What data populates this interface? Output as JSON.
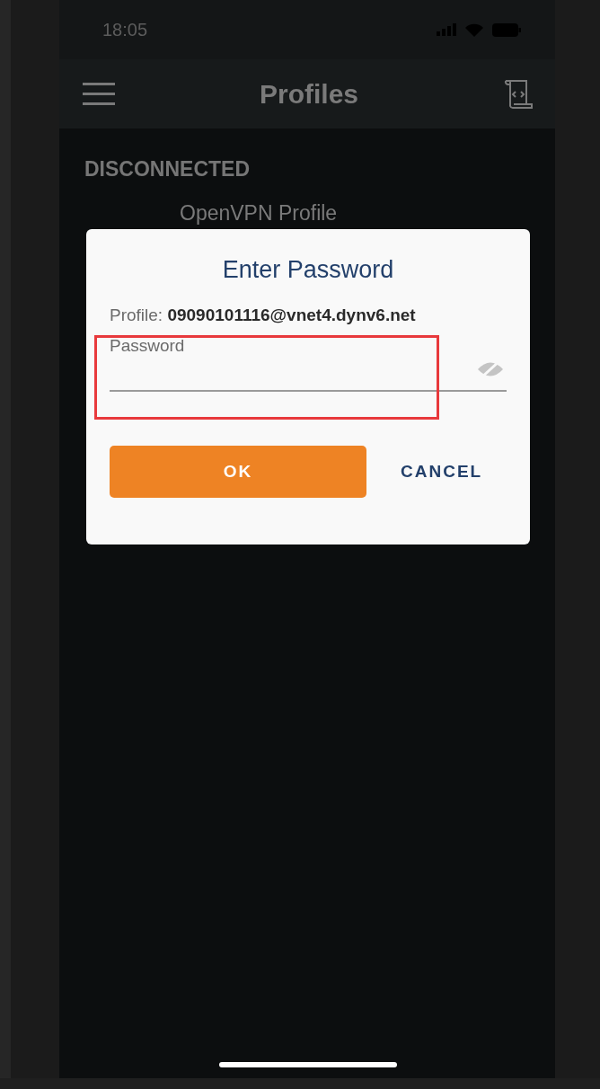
{
  "status_bar": {
    "time": "18:05"
  },
  "app_bar": {
    "title": "Profiles"
  },
  "section": {
    "title": "DISCONNECTED"
  },
  "profiles": [
    {
      "name": "OpenVPN Profile"
    }
  ],
  "dialog": {
    "title": "Enter Password",
    "profile_label": "Profile:",
    "profile_value": "09090101116@vnet4.dynv6.net",
    "password_field": {
      "placeholder": "Password",
      "highlighted": true
    },
    "buttons": [
      {
        "label": "OK",
        "kind": "primary"
      },
      {
        "label": "CANCEL",
        "kind": "text"
      }
    ]
  }
}
